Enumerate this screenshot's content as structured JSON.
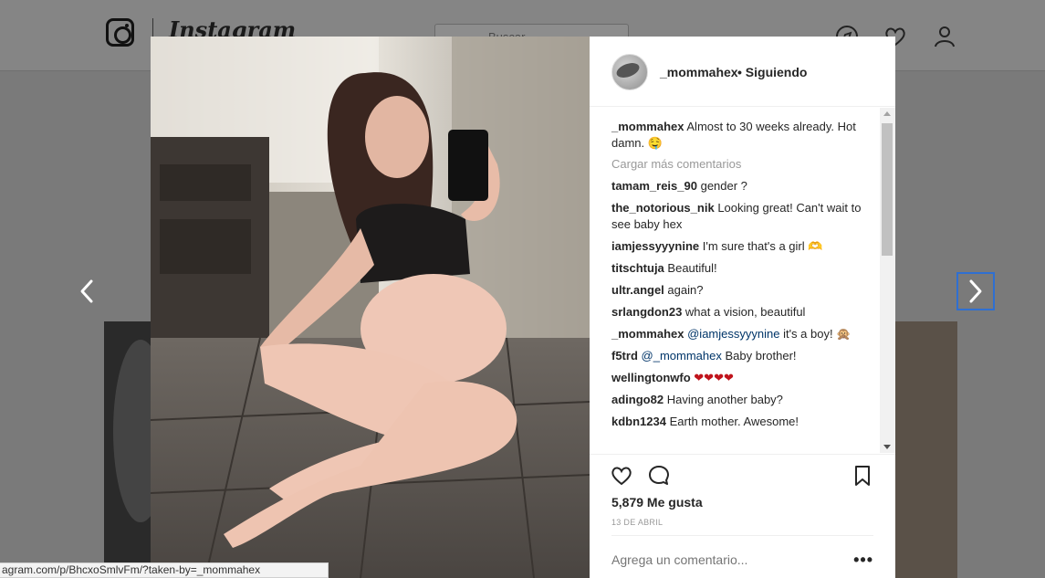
{
  "background": {
    "wordmark": "Instagram",
    "search_placeholder": "Buscar",
    "nav_icons": [
      "compass-icon",
      "heart-icon",
      "profile-icon"
    ]
  },
  "post": {
    "username": "_mommahex",
    "follow_status": "• Siguiendo",
    "caption": {
      "user": "_mommahex",
      "text": "Almost to 30 weeks already. Hot damn. 🤤"
    },
    "load_more": "Cargar más comentarios",
    "comments": [
      {
        "user": "tamam_reis_90",
        "text": "gender ?"
      },
      {
        "user": "the_notorious_nik",
        "text": "Looking great! Can't wait to see baby hex"
      },
      {
        "user": "iamjessyyynine",
        "text": "I'm sure that's a girl 🫶"
      },
      {
        "user": "titschtuja",
        "text": "Beautiful!"
      },
      {
        "user": "ultr.angel",
        "text": "again?"
      },
      {
        "user": "srlangdon23",
        "text": "what a vision, beautiful"
      },
      {
        "user": "_mommahex",
        "mention": "@iamjessyyynine",
        "text": "it's a boy! 🙊"
      },
      {
        "user": "f5trd",
        "mention": "@_mommahex",
        "text": "Baby brother!"
      },
      {
        "user": "wellingtonwfo",
        "text": "❤❤❤❤"
      },
      {
        "user": "adingo82",
        "text": "Having another baby?"
      },
      {
        "user": "kdbn1234",
        "text": "Earth mother. Awesome!"
      }
    ],
    "likes": "5,879 Me gusta",
    "date": "13 DE ABRIL",
    "add_comment_placeholder": "Agrega un comentario...",
    "more_label": "•••"
  },
  "status_bar": {
    "url": "agram.com/p/BhcxoSmlvFm/?taken-by=_mommahex"
  },
  "colors": {
    "overlay": "#7a7a7a",
    "mention": "#003569",
    "focus_outline": "#2f6fd1"
  }
}
